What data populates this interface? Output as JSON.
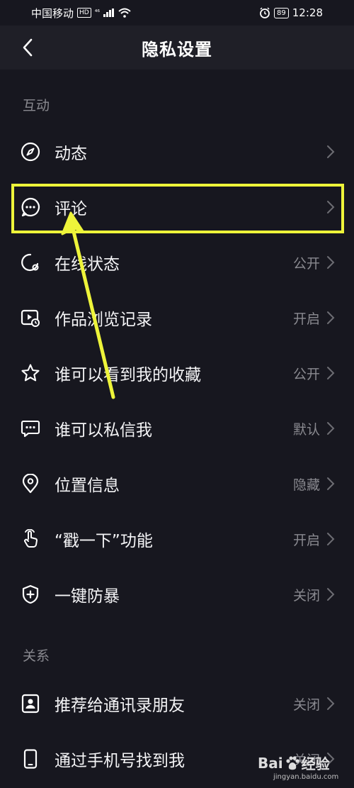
{
  "status_bar": {
    "carrier": "中国移动",
    "hd_badge": "HD",
    "signal": "⁴⁶",
    "battery": "89",
    "time": "12:28"
  },
  "header": {
    "title": "隐私设置"
  },
  "sections": [
    {
      "title": "互动",
      "items": [
        {
          "label": "动态",
          "value": "",
          "icon": "compass-icon"
        },
        {
          "label": "评论",
          "value": "",
          "icon": "comment-bubble-icon"
        },
        {
          "label": "在线状态",
          "value": "公开",
          "icon": "online-status-icon"
        },
        {
          "label": "作品浏览记录",
          "value": "开启",
          "icon": "video-history-icon"
        },
        {
          "label": "谁可以看到我的收藏",
          "value": "公开",
          "icon": "star-icon"
        },
        {
          "label": "谁可以私信我",
          "value": "默认",
          "icon": "message-icon"
        },
        {
          "label": "位置信息",
          "value": "隐藏",
          "icon": "location-pin-icon"
        },
        {
          "label": "“戳一下”功能",
          "value": "开启",
          "icon": "poke-hand-icon"
        },
        {
          "label": "一键防暴",
          "value": "关闭",
          "icon": "shield-plus-icon"
        }
      ]
    },
    {
      "title": "关系",
      "items": [
        {
          "label": "推荐给通讯录朋友",
          "value": "关闭",
          "icon": "contact-card-icon"
        },
        {
          "label": "通过手机号找到我",
          "value": "关闭",
          "icon": "phone-icon"
        }
      ]
    }
  ],
  "annotation": {
    "highlight_color": "#eef43a"
  },
  "watermark": {
    "brand_left": "Bai",
    "brand_right": "经验",
    "url": "jingyan.baidu.com"
  },
  "colors": {
    "background": "#17171f",
    "header_background": "#1f1f27",
    "text_primary": "#f4f4f6",
    "text_secondary": "#8a8a90"
  }
}
